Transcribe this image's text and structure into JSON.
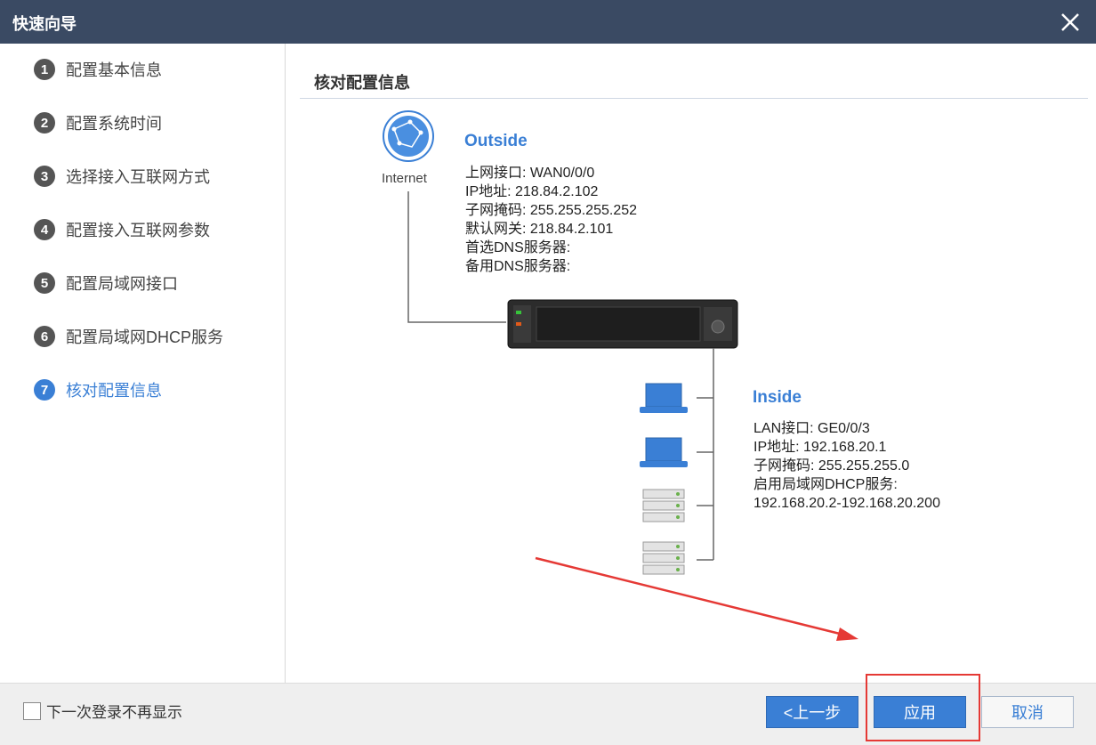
{
  "window": {
    "title": "快速向导",
    "close_icon": "close-icon"
  },
  "sidebar": {
    "steps": [
      {
        "num": "1",
        "label": "配置基本信息"
      },
      {
        "num": "2",
        "label": "配置系统时间"
      },
      {
        "num": "3",
        "label": "选择接入互联网方式"
      },
      {
        "num": "4",
        "label": "配置接入互联网参数"
      },
      {
        "num": "5",
        "label": "配置局域网接口"
      },
      {
        "num": "6",
        "label": "配置局域网DHCP服务"
      },
      {
        "num": "7",
        "label": "核对配置信息"
      }
    ],
    "active_step": 7
  },
  "main": {
    "title": "核对配置信息",
    "internet_label": "Internet",
    "outside": {
      "heading": "Outside",
      "lines": [
        "上网接口: WAN0/0/0",
        "IP地址: 218.84.2.102",
        "子网掩码: 255.255.255.252",
        "默认网关: 218.84.2.101",
        "首选DNS服务器:",
        "备用DNS服务器:"
      ]
    },
    "inside": {
      "heading": "Inside",
      "lines": [
        "LAN接口: GE0/0/3",
        "IP地址: 192.168.20.1",
        "子网掩码: 255.255.255.0",
        "启用局域网DHCP服务:",
        "192.168.20.2-192.168.20.200"
      ]
    }
  },
  "footer": {
    "checkbox_label": "下一次登录不再显示",
    "prev_label": "<上一步",
    "apply_label": "应用",
    "cancel_label": "取消"
  },
  "colors": {
    "accent": "#3a7fd5",
    "titlebar": "#3a4a63",
    "annotation": "#e53935"
  }
}
